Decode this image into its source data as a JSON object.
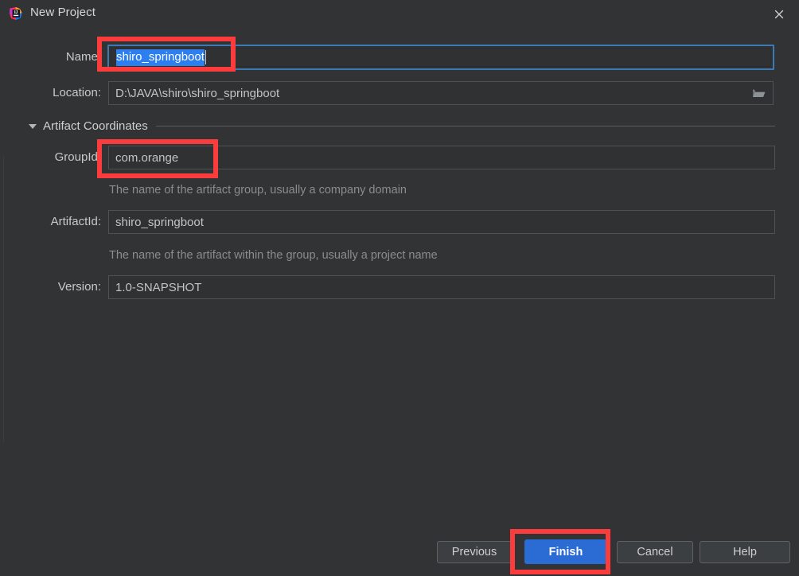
{
  "window": {
    "title": "New Project",
    "app_icon": "intellij-idea-icon",
    "close_icon": "close-icon"
  },
  "form": {
    "name": {
      "label": "Name:",
      "value": "shiro_springboot",
      "selected": true,
      "focused": true
    },
    "location": {
      "label": "Location:",
      "value": "D:\\JAVA\\shiro\\shiro_springboot",
      "browse_icon": "folder-open-icon"
    }
  },
  "section": {
    "title": "Artifact Coordinates",
    "expanded": true,
    "toggle_icon": "chevron-down-icon",
    "fields": [
      {
        "label": "GroupId:",
        "value": "com.orange",
        "hint": "The name of the artifact group, usually a company domain"
      },
      {
        "label": "ArtifactId:",
        "value": "shiro_springboot",
        "hint": "The name of the artifact within the group, usually a project name"
      },
      {
        "label": "Version:",
        "value": "1.0-SNAPSHOT",
        "hint": ""
      }
    ]
  },
  "buttons": {
    "previous": "Previous",
    "finish": "Finish",
    "cancel": "Cancel",
    "help": "Help"
  },
  "colors": {
    "dialog_background": "#313335",
    "field_background": "#2f3133",
    "field_border": "#4e5254",
    "focus_border": "#3d7ab5",
    "selection_background": "#2d7ff0",
    "primary_button": "#2a6bd4",
    "annotation_red": "#fa3c3c",
    "label_text": "#c9c9c9",
    "hint_text": "#8c8c8c"
  },
  "annotations": [
    {
      "name": "name-field-highlight",
      "target": "name-input"
    },
    {
      "name": "groupid-field-highlight",
      "target": "groupid-input"
    },
    {
      "name": "finish-button-highlight",
      "target": "finish-button"
    }
  ]
}
